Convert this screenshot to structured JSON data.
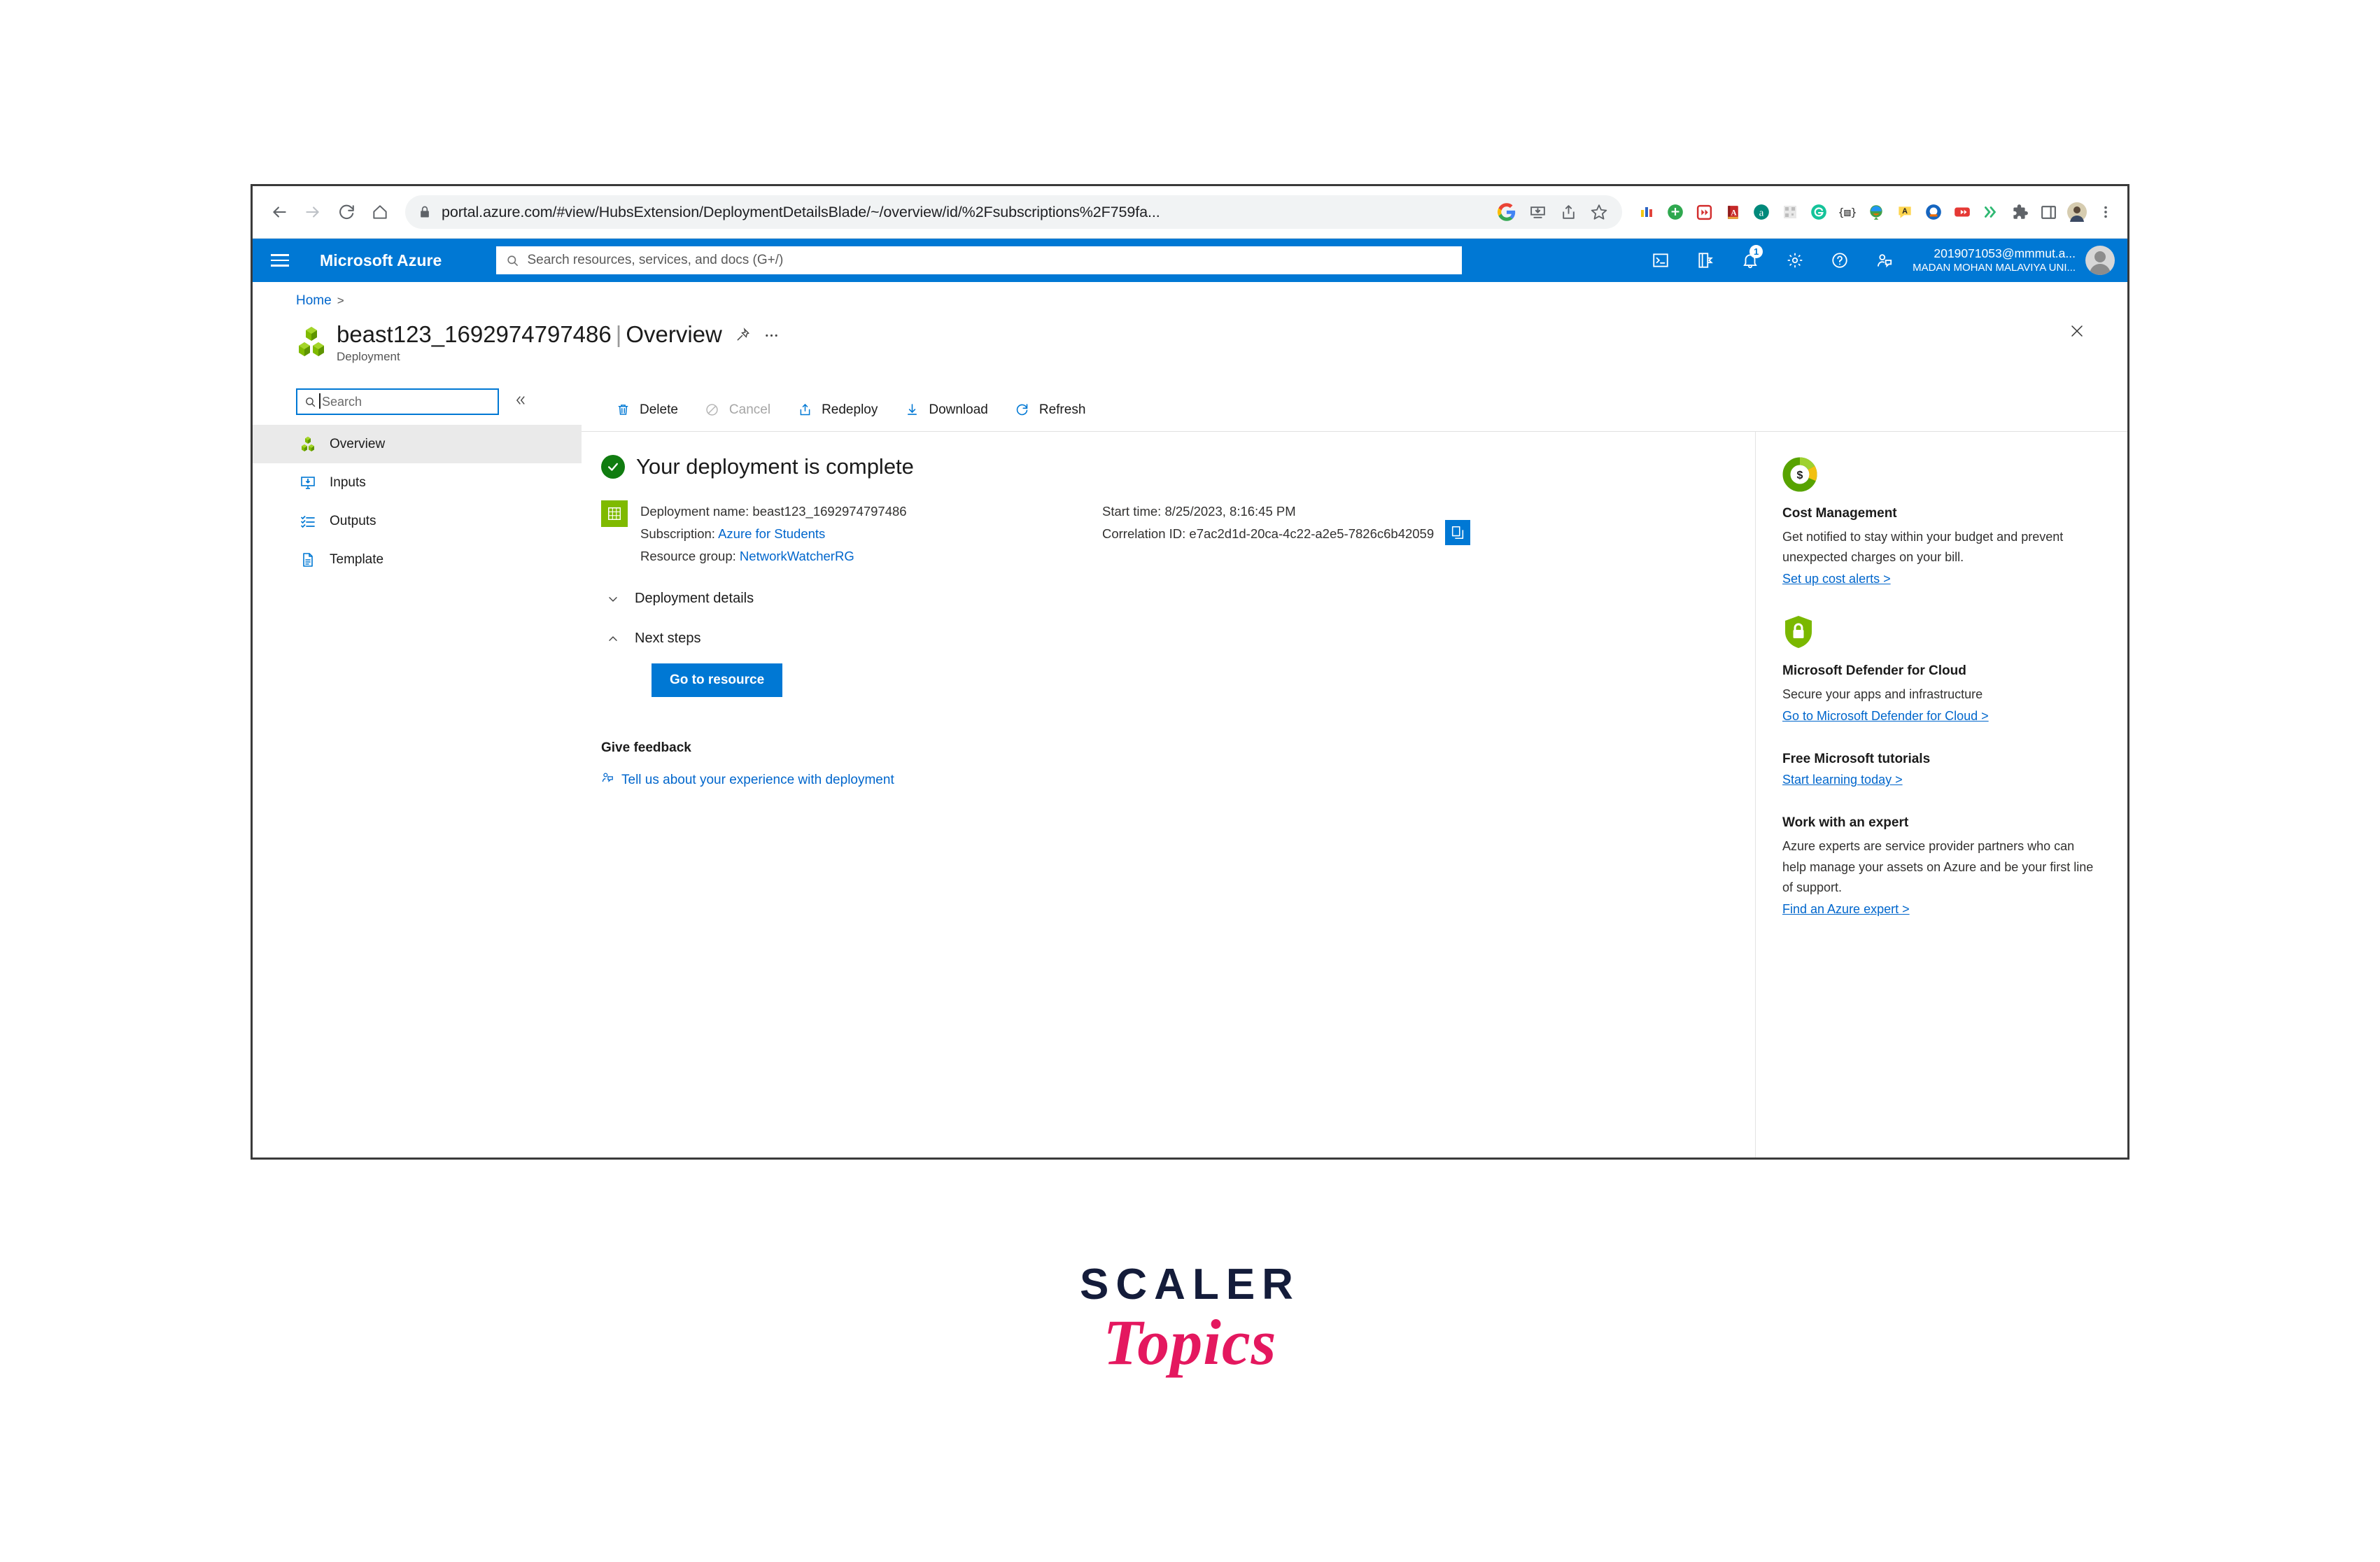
{
  "browser": {
    "back_icon": "back-arrow-icon",
    "forward_icon": "forward-arrow-icon",
    "reload_icon": "reload-icon",
    "home_icon": "home-icon",
    "url": "portal.azure.com/#view/HubsExtension/DeploymentDetailsBlade/~/overview/id/%2Fsubscriptions%2F759fa...",
    "lock_icon": "lock-icon",
    "omni_actions": [
      "google-icon",
      "install-app-icon",
      "share-icon",
      "bookmark-star-icon"
    ],
    "extensions": [
      "color-bars-icon",
      "green-plus-icon",
      "red-fast-forward-icon",
      "red-dictionary-icon",
      "teal-a-icon",
      "qr-code-icon",
      "grammarly-icon",
      "brackets-icon",
      "idm-globe-icon",
      "yellow-speech-bubble-icon",
      "blue-ring-icon",
      "youtube-downloader-icon",
      "green-chevrons-icon",
      "puzzle-extensions-icon",
      "side-panel-icon",
      "profile-avatar-icon",
      "chrome-menu-icon"
    ]
  },
  "azure_topbar": {
    "menu_icon": "hamburger-icon",
    "brand": "Microsoft Azure",
    "search_placeholder": "Search resources, services, and docs (G+/)",
    "search_icon": "search-icon",
    "icons": [
      {
        "name": "cloud-shell-icon"
      },
      {
        "name": "directories-subscriptions-icon"
      },
      {
        "name": "notifications-bell-icon",
        "badge": "1"
      },
      {
        "name": "settings-gear-icon"
      },
      {
        "name": "help-question-icon"
      },
      {
        "name": "feedback-icon"
      }
    ],
    "account_email": "2019071053@mmmut.a...",
    "account_org": "MADAN MOHAN MALAVIYA UNI...",
    "avatar": "user-avatar"
  },
  "breadcrumb": {
    "home": "Home",
    "separator": ">"
  },
  "page": {
    "title": "beast123_1692974797486",
    "title_divider": "|",
    "title_view": "Overview",
    "subtitle": "Deployment",
    "resource_icon": "deployment-cubes-icon",
    "pin_icon": "pin-icon",
    "more_icon": "ellipsis-icon",
    "close_icon": "close-icon"
  },
  "left_nav": {
    "search_placeholder": "Search",
    "search_icon": "search-icon",
    "collapse_icon": "double-chevron-left-icon",
    "items": [
      {
        "label": "Overview",
        "icon": "deployment-cubes-icon",
        "active": true
      },
      {
        "label": "Inputs",
        "icon": "inputs-monitor-icon",
        "active": false
      },
      {
        "label": "Outputs",
        "icon": "outputs-checklist-icon",
        "active": false
      },
      {
        "label": "Template",
        "icon": "template-document-icon",
        "active": false
      }
    ]
  },
  "command_bar": {
    "items": [
      {
        "label": "Delete",
        "icon": "trash-icon",
        "disabled": false
      },
      {
        "label": "Cancel",
        "icon": "cancel-circle-icon",
        "disabled": true
      },
      {
        "label": "Redeploy",
        "icon": "redeploy-upload-icon",
        "disabled": false
      },
      {
        "label": "Download",
        "icon": "download-arrow-icon",
        "disabled": false
      },
      {
        "label": "Refresh",
        "icon": "refresh-icon",
        "disabled": false
      }
    ]
  },
  "main": {
    "status_text": "Your deployment is complete",
    "status_icon": "success-check-icon",
    "summary_icon": "deployment-grid-icon",
    "deployment_name_label": "Deployment name:",
    "deployment_name_value": "beast123_1692974797486",
    "subscription_label": "Subscription:",
    "subscription_value": "Azure for Students",
    "resource_group_label": "Resource group:",
    "resource_group_value": "NetworkWatcherRG",
    "start_time_label": "Start time:",
    "start_time_value": "8/25/2023, 8:16:45 PM",
    "correlation_id_label": "Correlation ID:",
    "correlation_id_value": "e7ac2d1d-20ca-4c22-a2e5-7826c6b42059",
    "copy_icon": "copy-icon",
    "deployment_details_label": "Deployment details",
    "deployment_details_chevron": "chevron-down-icon",
    "next_steps_label": "Next steps",
    "next_steps_chevron": "chevron-up-icon",
    "go_to_resource_label": "Go to resource",
    "feedback_title": "Give feedback",
    "feedback_link": "Tell us about your experience with deployment",
    "feedback_icon": "feedback-person-icon"
  },
  "right_rail": {
    "cards": [
      {
        "icon": "cost-management-donut-icon",
        "heading": "Cost Management",
        "body": "Get notified to stay within your budget and prevent unexpected charges on your bill.",
        "link": "Set up cost alerts >"
      },
      {
        "icon": "defender-shield-lock-icon",
        "heading": "Microsoft Defender for Cloud",
        "body": "Secure your apps and infrastructure",
        "link": "Go to Microsoft Defender for Cloud >"
      },
      {
        "icon": null,
        "heading": "Free Microsoft tutorials",
        "body": "",
        "link": "Start learning today >"
      },
      {
        "icon": null,
        "heading": "Work with an expert",
        "body": "Azure experts are service provider partners who can help manage your assets on Azure and be your first line of support.",
        "link": "Find an Azure expert >"
      }
    ]
  },
  "watermark": {
    "line1": "SCALER",
    "line2": "Topics"
  },
  "colors": {
    "azure_blue": "#0078d4",
    "link_blue": "#0066cc",
    "success_green": "#107c10",
    "accent_green": "#7fba00",
    "scaler_navy": "#141c3a",
    "scaler_pink": "#e4185f"
  }
}
